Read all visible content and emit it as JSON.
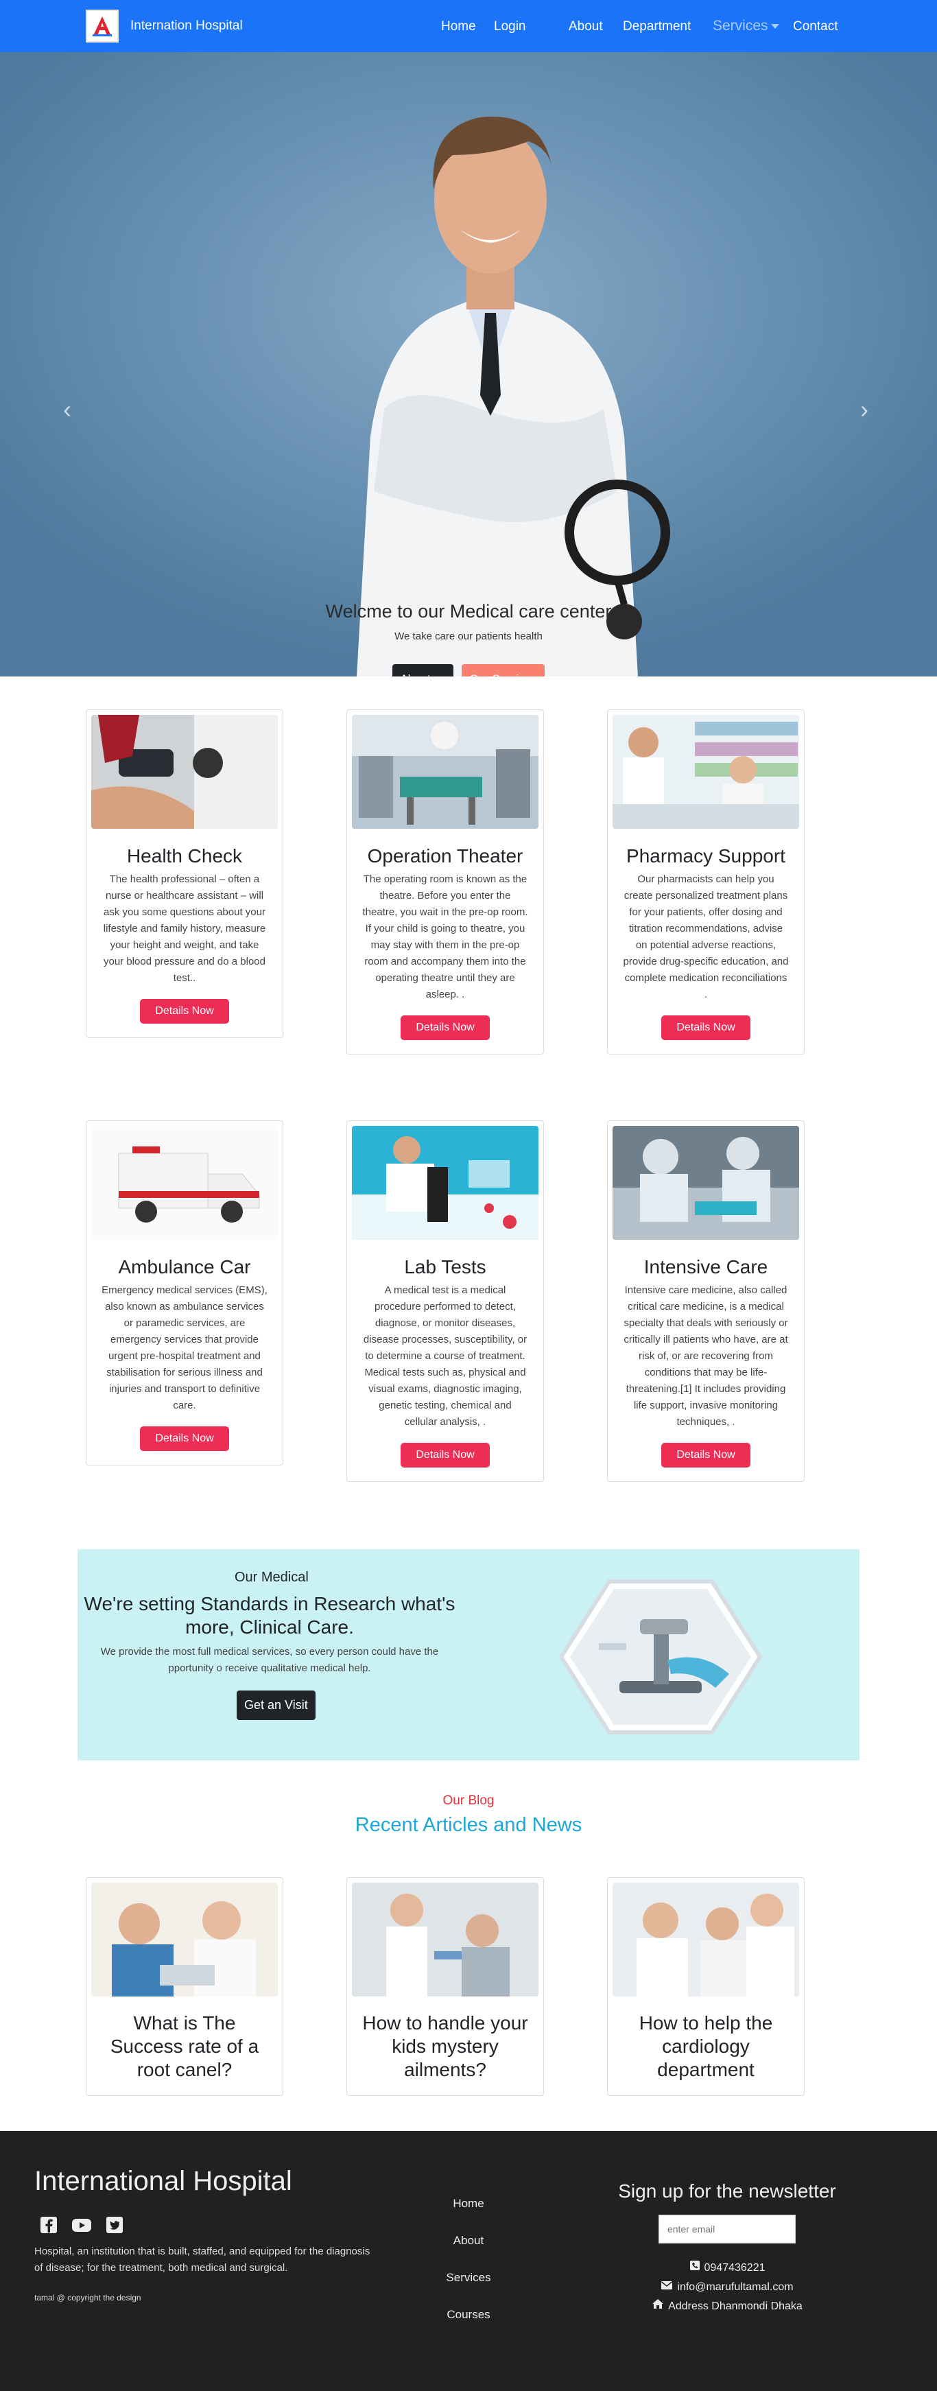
{
  "nav": {
    "brand": "Internation Hospital",
    "links": [
      "Home",
      "Login",
      "About",
      "Department",
      "Services",
      "Contact"
    ]
  },
  "hero": {
    "title": "Welcme to our Medical care center",
    "subtitle": "We take care our patients health",
    "btn_about": "About us",
    "btn_services": "Our Services",
    "prev_icon": "‹",
    "next_icon": "›"
  },
  "services": [
    {
      "title": "Health Check",
      "text": "The health professional – often a nurse or healthcare assistant – will ask you some questions about your lifestyle and family history, measure your height and weight, and take your blood pressure and do a blood test..",
      "button": "Details Now"
    },
    {
      "title": "Operation Theater",
      "text": "The operating room is known as the theatre. Before you enter the theatre, you wait in the pre-op room. If your child is going to theatre, you may stay with them in the pre-op room and accompany them into the operating theatre until they are asleep. .",
      "button": "Details Now"
    },
    {
      "title": "Pharmacy Support",
      "text": "Our pharmacists can help you create personalized treatment plans for your patients, offer dosing and titration recommendations, advise on potential adverse reactions, provide drug-specific education, and complete medication reconciliations .",
      "button": "Details Now"
    },
    {
      "title": "Ambulance Car",
      "text": "Emergency medical services (EMS), also known as ambulance services or paramedic services, are emergency services that provide urgent pre-hospital treatment and stabilisation for serious illness and injuries and transport to definitive care.",
      "button": "Details Now"
    },
    {
      "title": "Lab Tests",
      "text": "A medical test is a medical procedure performed to detect, diagnose, or monitor diseases, disease processes, susceptibility, or to determine a course of treatment. Medical tests such as, physical and visual exams, diagnostic imaging, genetic testing, chemical and cellular analysis, .",
      "button": "Details Now"
    },
    {
      "title": "Intensive Care",
      "text": "Intensive care medicine, also called critical care medicine, is a medical specialty that deals with seriously or critically ill patients who have, are at risk of, or are recovering from conditions that may be life-threatening.[1] It includes providing life support, invasive monitoring techniques, .",
      "button": "Details Now"
    }
  ],
  "research": {
    "kicker": "Our Medical",
    "title": "We're setting Standards in Research what's more, Clinical Care.",
    "text": "We provide the most full medical services, so every person could have the pportunity o receive qualitative medical help.",
    "button": "Get an Visit"
  },
  "blog": {
    "kicker": "Our Blog",
    "title": "Recent Articles and News",
    "posts": [
      {
        "title": "What is The Success rate of a root canel?"
      },
      {
        "title": "How to handle your kids mystery ailments?"
      },
      {
        "title": "How to help the cardiology department"
      }
    ]
  },
  "footer": {
    "title": "International Hospital",
    "description": "Hospital, an institution that is built, staffed, and equipped for the diagnosis of disease; for the treatment, both medical and surgical.",
    "copyright": "tamal @ copyright the design",
    "links": [
      "Home",
      "About",
      "Services",
      "Courses"
    ],
    "newsletter_title": "Sign up for the newsletter",
    "email_placeholder": "enter email",
    "phone": "0947436221",
    "email": "info@marufultamal.com",
    "address": "Address Dhanmondi Dhaka"
  }
}
